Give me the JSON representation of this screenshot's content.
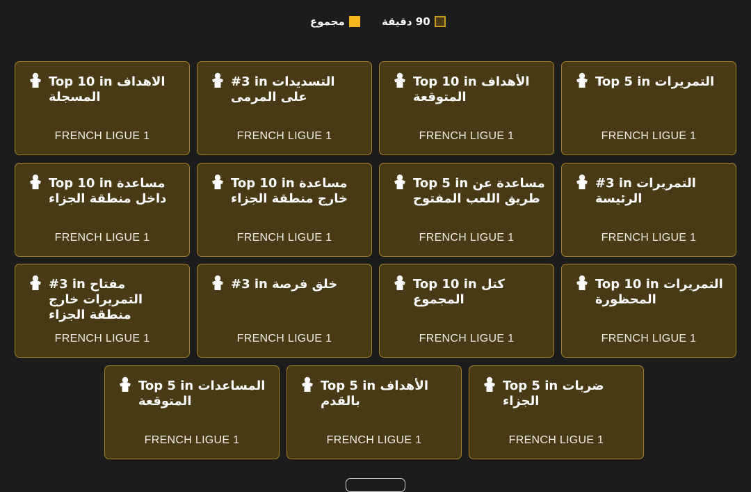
{
  "legend": {
    "total_label": "مجموع",
    "total_color": "#f5b81c",
    "per90_label": "90 دقيقة",
    "per90_color": "#4a3a16"
  },
  "league": "FRENCH LIGUE 1",
  "player_icon": "player-shirt-icon",
  "cards": [
    {
      "badge": "Top 10 in الاهداف المسجلة"
    },
    {
      "badge": "#3 in التسديدات على المرمى"
    },
    {
      "badge": "Top 10 in الأهداف المتوقعة"
    },
    {
      "badge": "Top 5 in التمريرات"
    },
    {
      "badge": "Top 10 in مساعدة داخل منطقة الجزاء"
    },
    {
      "badge": "Top 10 in مساعدة خارج منطقة الجزاء"
    },
    {
      "badge": "Top 5 in مساعدة عن طريق اللعب المفتوح"
    },
    {
      "badge": "#3 in التمريرات الرئيسة"
    },
    {
      "badge": "#3 in مفتاح التمريرات خارج منطقة الجزاء"
    },
    {
      "badge": "#3 in خلق فرصة"
    },
    {
      "badge": "Top 10 in كتل المجموع"
    },
    {
      "badge": "Top 10 in التمريرات المحظورة"
    },
    {
      "badge": "Top 5 in المساعدات المتوقعة"
    },
    {
      "badge": "Top 5 in الأهداف بالقدم"
    },
    {
      "badge": "Top 5 in ضربات الجزاء"
    }
  ]
}
